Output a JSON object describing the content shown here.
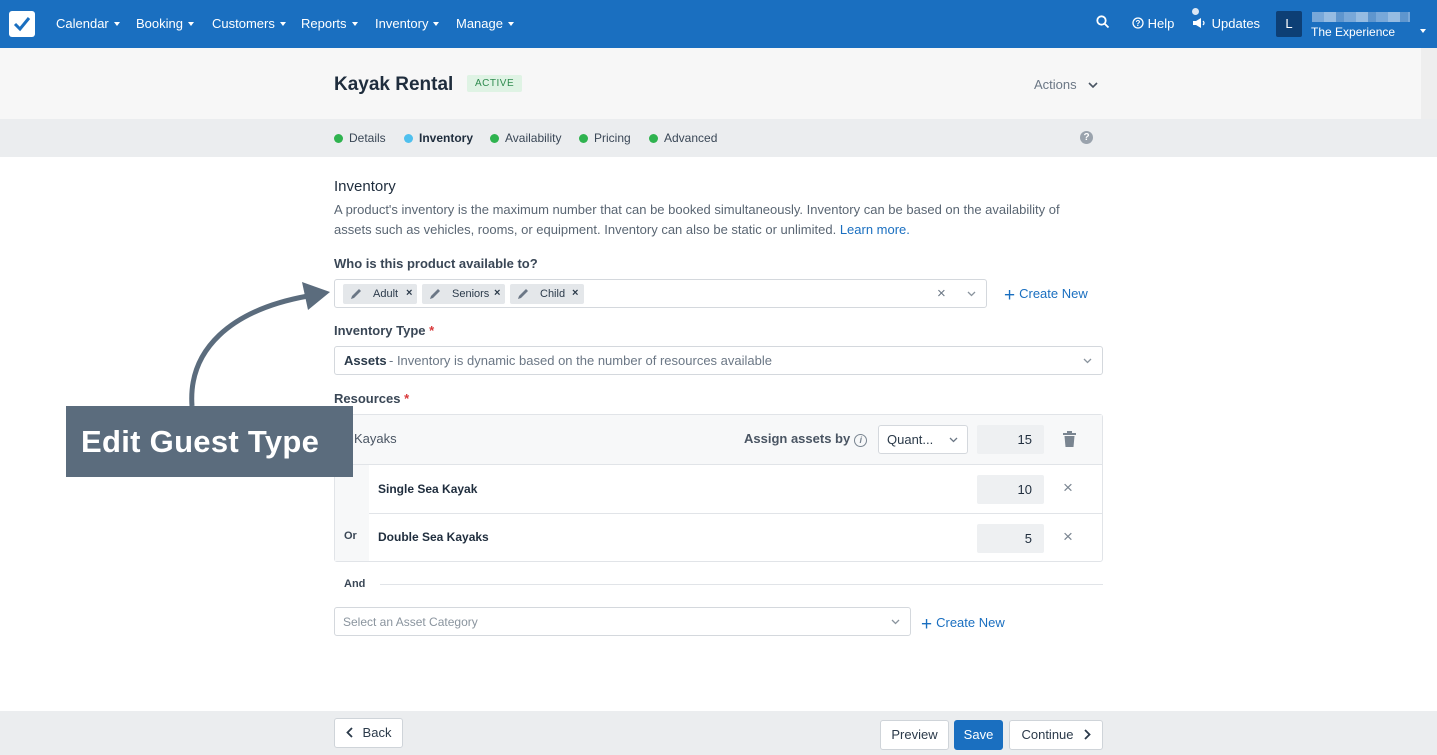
{
  "nav": {
    "items": [
      "Calendar",
      "Booking",
      "Customers",
      "Reports",
      "Inventory",
      "Manage"
    ],
    "help": "Help",
    "updates": "Updates",
    "avatar_initial": "L",
    "account_name": "The Experience"
  },
  "header": {
    "title": "Kayak Rental",
    "status": "ACTIVE",
    "actions": "Actions"
  },
  "steps": [
    {
      "label": "Details",
      "color": "#2fb34f"
    },
    {
      "label": "Inventory",
      "color": "#4fc0ee"
    },
    {
      "label": "Availability",
      "color": "#2fb34f"
    },
    {
      "label": "Pricing",
      "color": "#2fb34f"
    },
    {
      "label": "Advanced",
      "color": "#2fb34f"
    }
  ],
  "inventory": {
    "section_title": "Inventory",
    "description": "A product's inventory is the maximum number that can be booked simultaneously. Inventory can be based on the availability of assets such as vehicles, rooms, or equipment. Inventory can also be static or unlimited.",
    "learn_more": "Learn more.",
    "available_to_label": "Who is this product available to?",
    "guest_types": [
      "Adult",
      "Seniors",
      "Child"
    ],
    "create_new": "Create New",
    "inventory_type_label": "Inventory Type",
    "inventory_type_value": "Assets",
    "inventory_type_desc": "- Inventory is dynamic based on the number of resources available",
    "resources_label": "Resources",
    "resource_group": "Kayaks",
    "assign_by_label": "Assign assets by",
    "assign_by_value": "Quant...",
    "group_quantity": "15",
    "rows": [
      {
        "prefix": "",
        "name": "Single Sea Kayak",
        "quantity": "10"
      },
      {
        "prefix": "Or",
        "name": "Double Sea Kayaks",
        "quantity": "5"
      }
    ],
    "and_label": "And",
    "asset_category_placeholder": "Select an Asset Category",
    "create_new_2": "Create New"
  },
  "footer": {
    "back": "Back",
    "preview": "Preview",
    "save": "Save",
    "continue": "Continue"
  },
  "annotation": {
    "text": "Edit Guest Type"
  }
}
